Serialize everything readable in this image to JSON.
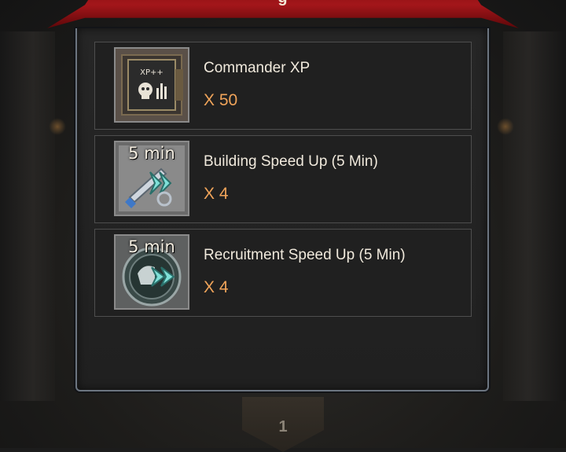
{
  "banner": {
    "title": "g",
    "color": "#a3161a"
  },
  "rewards": [
    {
      "name": "Commander XP",
      "quantity": "X 50",
      "icon": "xp-book-icon",
      "badge": "XP++"
    },
    {
      "name": "Building Speed Up (5 Min)",
      "quantity": "X 4",
      "icon": "wrench-speedup-icon",
      "timer": "5 min"
    },
    {
      "name": "Recruitment Speed Up (5 Min)",
      "quantity": "X 4",
      "icon": "helmet-speedup-icon",
      "timer": "5 min"
    }
  ],
  "footer": {
    "badge_number": "1"
  },
  "colors": {
    "quantity": "#f0a45a",
    "name": "#f0e9dc",
    "panel_border": "#6c7580"
  }
}
